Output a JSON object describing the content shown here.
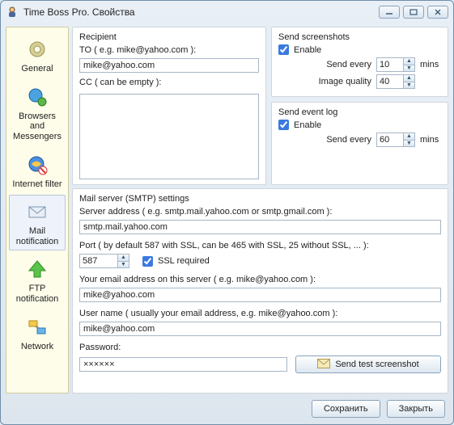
{
  "window": {
    "title": "Time Boss Pro. Свойства"
  },
  "sidebar": {
    "items": [
      {
        "label": "General"
      },
      {
        "label": "Browsers and Messengers"
      },
      {
        "label": "Internet filter"
      },
      {
        "label": "Mail notification"
      },
      {
        "label": "FTP notification"
      },
      {
        "label": "Network"
      }
    ]
  },
  "recipient": {
    "heading": "Recipient",
    "to_label": "TO ( e.g. mike@yahoo.com ):",
    "to_value": "mike@yahoo.com",
    "cc_label": "CC ( can be empty ):",
    "cc_value": ""
  },
  "screenshots": {
    "heading": "Send screenshots",
    "enable_label": "Enable",
    "enable_checked": true,
    "send_every_label": "Send every",
    "send_every_value": "10",
    "mins": "mins",
    "quality_label": "Image quality",
    "quality_value": "40"
  },
  "eventlog": {
    "heading": "Send event log",
    "enable_label": "Enable",
    "enable_checked": true,
    "send_every_label": "Send every",
    "send_every_value": "60",
    "mins": "mins"
  },
  "smtp": {
    "heading": "Mail server (SMTP) settings",
    "server_label": "Server address   ( e.g. smtp.mail.yahoo.com or smtp.gmail.com ):",
    "server_value": "smtp.mail.yahoo.com",
    "port_label": "Port   ( by default 587 with SSL, can be 465 with SSL, 25 without SSL, ... ):",
    "port_value": "587",
    "ssl_label": "SSL required",
    "ssl_checked": true,
    "your_email_label": "Your email address on this server ( e.g. mike@yahoo.com ):",
    "your_email_value": "mike@yahoo.com",
    "user_label": "User name  ( usually your email address, e.g. mike@yahoo.com ):",
    "user_value": "mike@yahoo.com",
    "password_label": "Password:",
    "password_value": "××××××",
    "test_button": "Send test screenshot"
  },
  "footer": {
    "save": "Сохранить",
    "close": "Закрыть"
  }
}
